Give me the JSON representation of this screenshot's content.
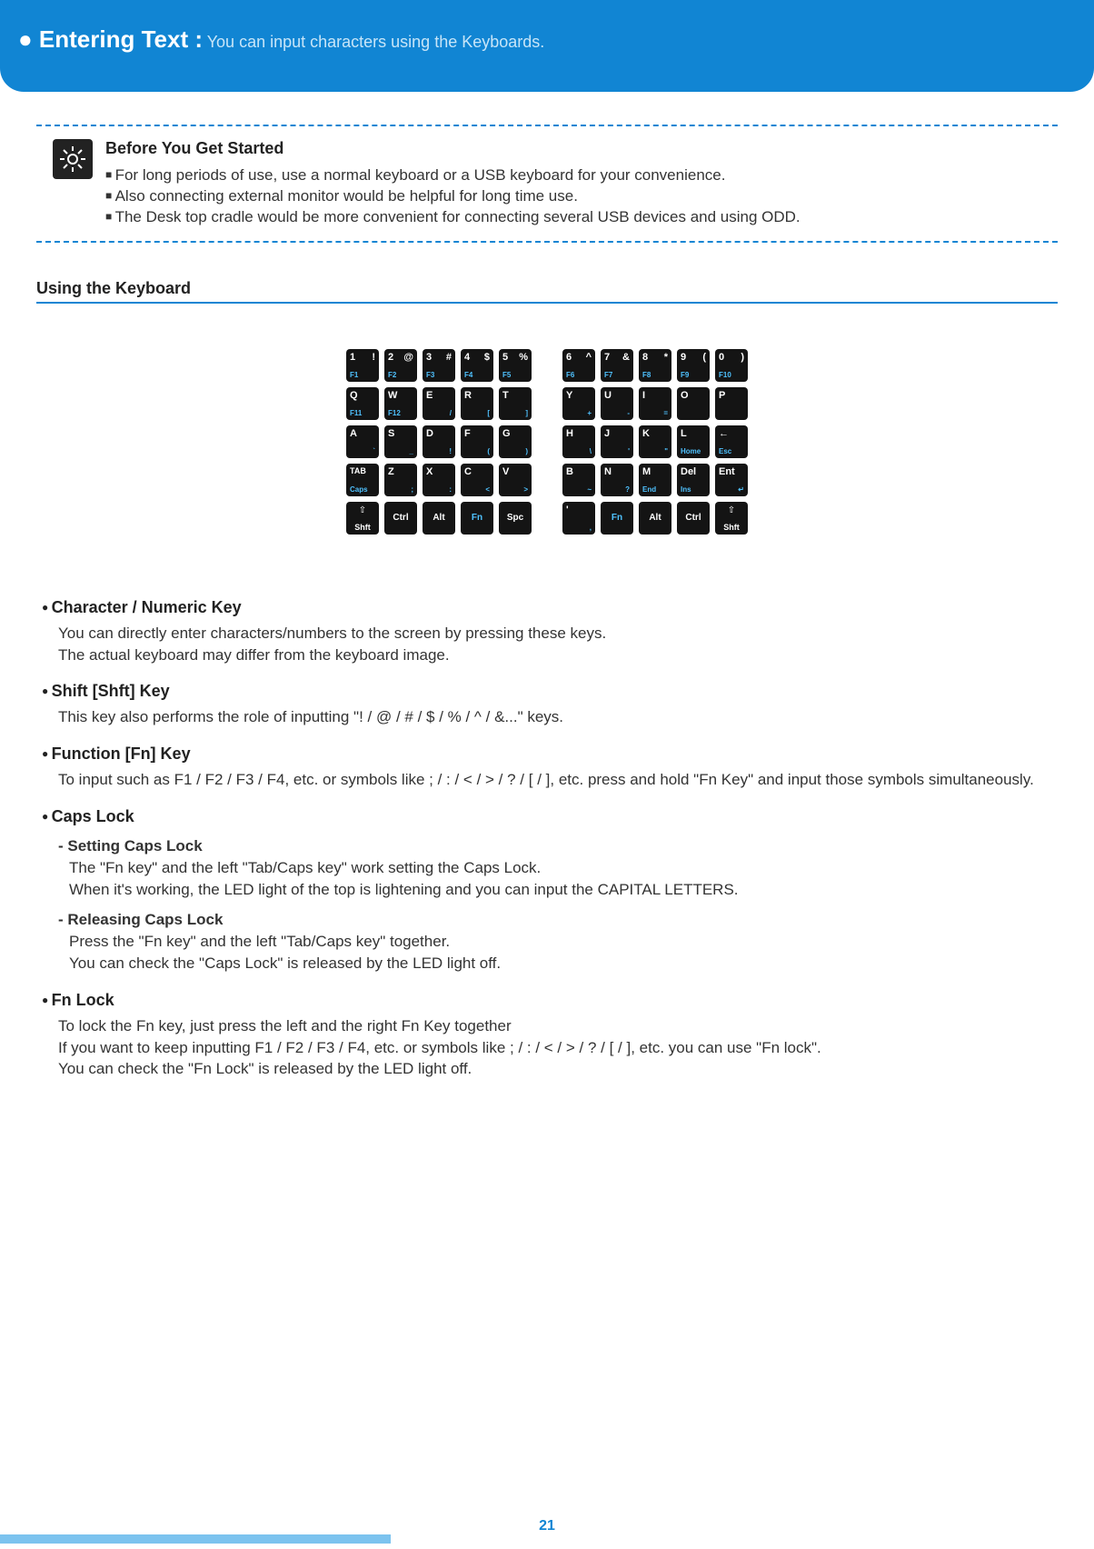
{
  "header": {
    "title": "● Entering Text :",
    "subtitle": " You can input characters using the Keyboards."
  },
  "before_start": {
    "title": "Before You Get Started",
    "items": [
      "For long periods of use, use a normal keyboard or a USB keyboard for your convenience.",
      "Also connecting external monitor would be helpful for long time use.",
      "The Desk top cradle would be more convenient for connecting several USB devices and using ODD."
    ]
  },
  "section_heading": "Using the Keyboard",
  "keyboard": {
    "left": [
      [
        {
          "tl": "1",
          "tr": "!",
          "bl": "F1"
        },
        {
          "tl": "2",
          "tr": "@",
          "bl": "F2"
        },
        {
          "tl": "3",
          "tr": "#",
          "bl": "F3"
        },
        {
          "tl": "4",
          "tr": "$",
          "bl": "F4"
        },
        {
          "tl": "5",
          "tr": "%",
          "bl": "F5"
        }
      ],
      [
        {
          "tl": "Q",
          "bl": "F11"
        },
        {
          "tl": "W",
          "bl": "F12"
        },
        {
          "tl": "E",
          "br": "/"
        },
        {
          "tl": "R",
          "br": "["
        },
        {
          "tl": "T",
          "br": "]"
        }
      ],
      [
        {
          "tl": "A",
          "br": "`"
        },
        {
          "tl": "S",
          "br": "_"
        },
        {
          "tl": "D",
          "br": "!"
        },
        {
          "tl": "F",
          "br": "("
        },
        {
          "tl": "G",
          "br": ")"
        }
      ],
      [
        {
          "tl": "TAB",
          "bl": "Caps",
          "small": true
        },
        {
          "tl": "Z",
          "br": ";"
        },
        {
          "tl": "X",
          "br": ":"
        },
        {
          "tl": "C",
          "br": "<"
        },
        {
          "tl": "V",
          "br": ">"
        }
      ],
      [
        {
          "shift": true,
          "label": "Shft"
        },
        {
          "ct": "Ctrl"
        },
        {
          "ct": "Alt"
        },
        {
          "ct": "Fn",
          "blue": true
        },
        {
          "ct": "Spc"
        }
      ]
    ],
    "right": [
      [
        {
          "tl": "6",
          "tr": "^",
          "bl": "F6"
        },
        {
          "tl": "7",
          "tr": "&",
          "bl": "F7"
        },
        {
          "tl": "8",
          "tr": "*",
          "bl": "F8"
        },
        {
          "tl": "9",
          "tr": "(",
          "bl": "F9"
        },
        {
          "tl": "0",
          "tr": ")",
          "bl": "F10"
        }
      ],
      [
        {
          "tl": "Y",
          "br": "+"
        },
        {
          "tl": "U",
          "br": "-"
        },
        {
          "tl": "I",
          "br": "="
        },
        {
          "tl": "O"
        },
        {
          "tl": "P"
        }
      ],
      [
        {
          "tl": "H",
          "br": "\\"
        },
        {
          "tl": "J",
          "br": "'"
        },
        {
          "tl": "K",
          "br": "\""
        },
        {
          "tl": "L",
          "bl": "Home"
        },
        {
          "tl": "←",
          "bl": "Esc"
        }
      ],
      [
        {
          "tl": "B",
          "br": "~"
        },
        {
          "tl": "N",
          "br": "?"
        },
        {
          "tl": "M",
          "bl": "End"
        },
        {
          "tl": "Del",
          "bl": "Ins"
        },
        {
          "tl": "Ent",
          "br": "↵"
        }
      ],
      [
        {
          "tl": "'",
          "br": ","
        },
        {
          "ct": "Fn",
          "blue": true
        },
        {
          "ct": "Alt"
        },
        {
          "ct": "Ctrl"
        },
        {
          "shift": true,
          "label": "Shft"
        }
      ]
    ]
  },
  "descriptions": [
    {
      "head": "Character / Numeric Key",
      "body": [
        "You can directly enter characters/numbers to the screen by pressing these keys.",
        "The actual keyboard may differ from the keyboard image."
      ]
    },
    {
      "head": "Shift [Shft] Key",
      "body": [
        "This key also performs the role of inputting \"! / @ / # / $ / % / ^ / &...\" keys."
      ]
    },
    {
      "head": "Function [Fn] Key",
      "body": [
        "To input such as F1 / F2 / F3 / F4, etc. or symbols like ; / : / < / > / ? / [ / ], etc. press and hold \"Fn Key\" and input those symbols simultaneously."
      ]
    },
    {
      "head": "Caps Lock",
      "subs": [
        {
          "subhead": "Setting Caps Lock",
          "subbody": [
            "The \"Fn key\" and the left \"Tab/Caps key\" work setting the Caps Lock.",
            "When it's working, the LED light of the top is lightening and you can input the CAPITAL LETTERS."
          ]
        },
        {
          "subhead": "Releasing Caps Lock",
          "subbody": [
            "Press the \"Fn key\" and the left \"Tab/Caps key\" together.",
            "You can check the \"Caps Lock\" is released by the LED light off."
          ]
        }
      ]
    },
    {
      "head": "Fn Lock",
      "body": [
        "To lock the Fn key, just press the left and the right Fn Key together",
        "If you want to keep inputting F1 / F2 / F3 / F4, etc. or symbols like ; / : / < / > / ? / [ / ], etc. you can use \"Fn lock\".",
        "You can check the \"Fn Lock\" is released by the LED light off."
      ]
    }
  ],
  "page_number": "21"
}
